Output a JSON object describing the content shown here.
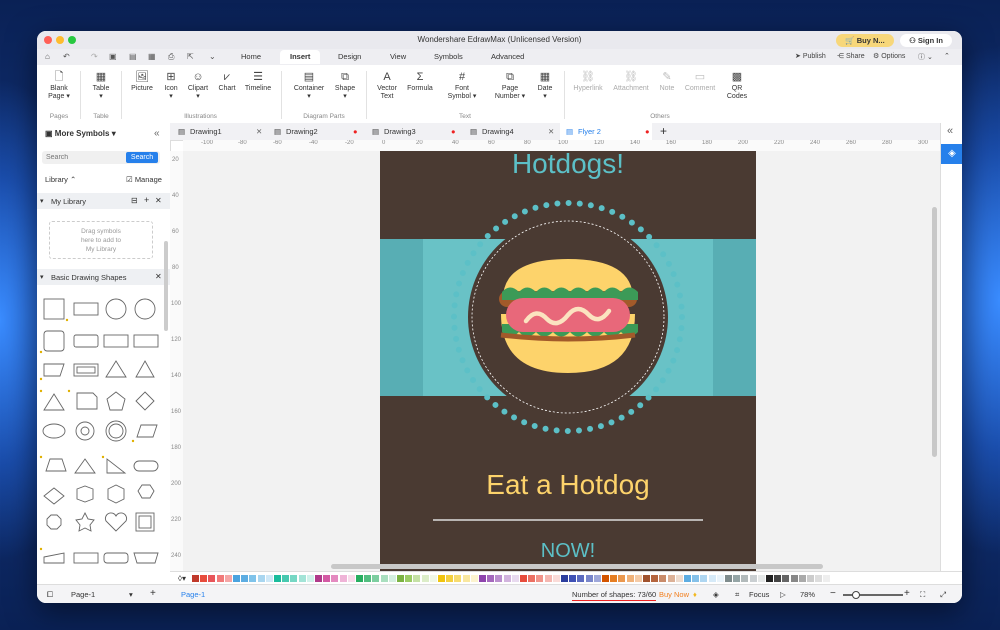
{
  "window": {
    "title": "Wondershare EdrawMax (Unlicensed Version)",
    "buy_label": "Buy N...",
    "sign_in_label": "Sign In"
  },
  "menu": {
    "tabs": [
      "Home",
      "Insert",
      "Design",
      "View",
      "Symbols",
      "Advanced"
    ],
    "active_tab": "Insert",
    "publish": "Publish",
    "share": "Share",
    "options": "Options"
  },
  "ribbon": {
    "buttons": {
      "blank_page": [
        "Blank",
        "Page"
      ],
      "table": "Table",
      "picture": "Picture",
      "icon": "Icon",
      "clipart": "Clipart",
      "chart": "Chart",
      "timeline": "Timeline",
      "container": "Container",
      "shape": "Shape",
      "vector_text": [
        "Vector",
        "Text"
      ],
      "formula": "Formula",
      "font_symbol": [
        "Font",
        "Symbol"
      ],
      "page_number": [
        "Page",
        "Number"
      ],
      "date": "Date",
      "hyperlink": "Hyperlink",
      "attachment": "Attachment",
      "note": "Note",
      "comment": "Comment",
      "qr_codes": [
        "QR",
        "Codes"
      ]
    },
    "groups": {
      "pages": "Pages",
      "table": "Table",
      "illustrations": "Illustrations",
      "diagram_parts": "Diagram Parts",
      "text": "Text",
      "others": "Others"
    }
  },
  "sidebar": {
    "title": "More Symbols",
    "search_placeholder": "Search",
    "search_button": "Search",
    "library_label": "Library",
    "manage_label": "Manage",
    "my_library": "My Library",
    "drag_hint": [
      "Drag symbols",
      "here to add to",
      "My Library"
    ],
    "basic_shapes": "Basic Drawing Shapes"
  },
  "doc_tabs": [
    {
      "label": "Drawing1",
      "active": false,
      "modified": false
    },
    {
      "label": "Drawing2",
      "active": false,
      "modified": true
    },
    {
      "label": "Drawing3",
      "active": false,
      "modified": true
    },
    {
      "label": "Drawing4",
      "active": false,
      "modified": false
    },
    {
      "label": "Flyer 2",
      "active": true,
      "modified": true
    }
  ],
  "ruler": {
    "h_ticks": [
      "-100",
      "-80",
      "-60",
      "-40",
      "-20",
      "0",
      "20",
      "40",
      "60",
      "80",
      "100",
      "120",
      "140",
      "160",
      "180",
      "200",
      "220",
      "240",
      "260",
      "280",
      "300"
    ],
    "v_ticks": [
      "20",
      "40",
      "60",
      "80",
      "100",
      "120",
      "140",
      "160",
      "180",
      "200",
      "220",
      "240"
    ]
  },
  "flyer": {
    "heading": "Hotdogs!",
    "tagline": "Eat a Hotdog",
    "cta": "NOW!",
    "colors": {
      "background": "#4a3a32",
      "band": "#58aeb4",
      "accent": "#fdd36b",
      "teal_text": "#5cc0c7"
    }
  },
  "palette": [
    "#c0392b",
    "#e74c3c",
    "#e8555a",
    "#f17a7a",
    "#f5a6a6",
    "#4aa3df",
    "#5dade2",
    "#7fc3ea",
    "#a9d6f0",
    "#cfe8f7",
    "#1abc9c",
    "#48c9b0",
    "#76d7c4",
    "#a3e4d7",
    "#d1f2eb",
    "#b03a8a",
    "#d35aa4",
    "#e48ac0",
    "#efb3d7",
    "#f8dbeb",
    "#27ae60",
    "#52be80",
    "#7dcea0",
    "#a9dfbf",
    "#d4efdf",
    "#7cb342",
    "#9ccc65",
    "#c5e1a5",
    "#dcedc8",
    "#f0f7e6",
    "#f1c40f",
    "#f4d03f",
    "#f7dc6f",
    "#f9e79f",
    "#fcf3cf",
    "#8e44ad",
    "#a569bd",
    "#bb8fce",
    "#d2b4de",
    "#e8daef",
    "#e74c3c",
    "#ec7063",
    "#f1948a",
    "#f5b7b1",
    "#fadbd8",
    "#2c3e9e",
    "#3f51b5",
    "#5c6bc0",
    "#7986cb",
    "#9fa8da",
    "#d35400",
    "#e67e22",
    "#eb984e",
    "#f0b27a",
    "#f5cba7",
    "#a0522d",
    "#b5653e",
    "#c98b6a",
    "#dcb197",
    "#eedccf",
    "#5dade2",
    "#85c1e9",
    "#aed6f1",
    "#d6eaf8",
    "#eaf4fb",
    "#7f8c8d",
    "#95a5a6",
    "#b2babb",
    "#cacfd2",
    "#e5e8e8",
    "#222222",
    "#444444",
    "#666666",
    "#888888",
    "#aaaaaa",
    "#cccccc",
    "#dddddd",
    "#eeeeee"
  ],
  "status": {
    "page_name": "Page-1",
    "page_tab": "Page-1",
    "shapes_count": "Number of shapes: 73/60",
    "buy_now": "Buy Now",
    "focus": "Focus",
    "zoom": "78%"
  }
}
